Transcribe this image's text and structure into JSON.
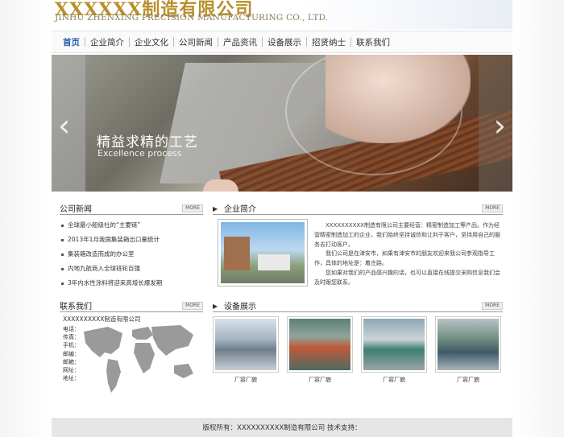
{
  "header": {
    "logo_cn": "XXXXXX制造有限公司",
    "logo_en": "JINHU ZHENXING PRECISION MANUFACTURING CO., LTD."
  },
  "nav": {
    "items": [
      "首页",
      "企业简介",
      "企业文化",
      "公司新闻",
      "产品资讯",
      "设备展示",
      "招贤纳士",
      "联系我们"
    ]
  },
  "banner": {
    "title": "精益求精的工艺",
    "subtitle": "Excellence process",
    "prev": "‹",
    "next": "›"
  },
  "news": {
    "title": "公司新闻",
    "more": "MORE",
    "items": [
      "全球最小船级社的“主要链”",
      "2013年1月我国集装箱出口量统计",
      "集装箱改造而成的办公室",
      "内地九航商入全球班轮百强",
      "3年内水性涂料将迎来高增长爆发期"
    ]
  },
  "intro": {
    "title": "企业简介",
    "more": "MORE",
    "paragraphs": [
      "XXXXXXXXXX制造有限公司主要经营：精密制造加工等产品。作为经营精密制造加工的企业，我们始终坚持诚信和让利于客户，坚持用自己的服务去打动客户。",
      "我们公司是在津安市，如果有津安市的朋友欢迎来我公司参观指导工作，具体的地址是：着庄路。",
      "您如果对我们的产品感兴趣的话，也可以直接在线提交采购信息我们会及时跟您联系。"
    ]
  },
  "contact": {
    "title": "联系我们",
    "more": "MORE",
    "company": "XXXXXXXXXX制造有限公司",
    "rows": [
      "电话：",
      "传真：",
      "手机：",
      "邮编：",
      "邮箱：",
      "网址：",
      "地址："
    ]
  },
  "equipment": {
    "title": "设备展示",
    "more": "MORE",
    "captions": [
      "厂容厂貌",
      "厂容厂貌",
      "厂容厂貌",
      "厂容厂貌"
    ]
  },
  "footer": {
    "text": "版权所有：XXXXXXXXXX制造有限公司     技术支持："
  },
  "colors": {
    "logo_gold": "#b8902a",
    "nav_active": "#2a5db0",
    "footer_bg": "#e6e6e6"
  }
}
